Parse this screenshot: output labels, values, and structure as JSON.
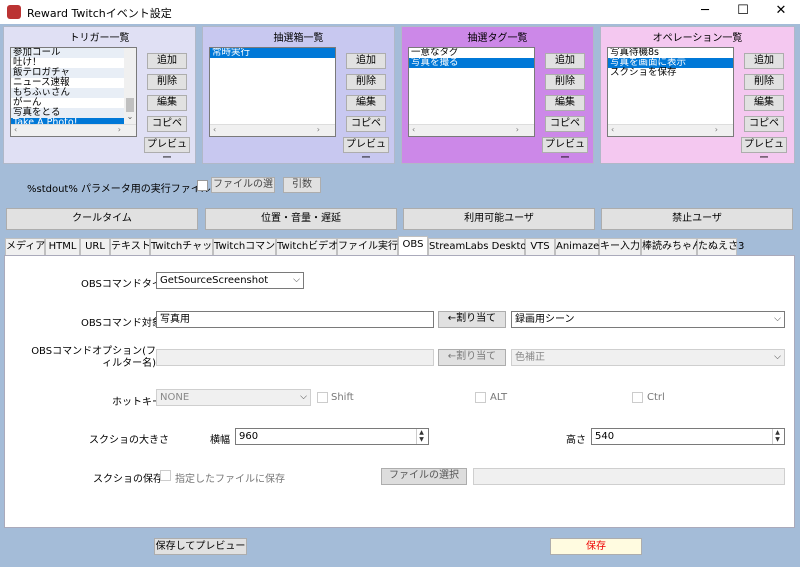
{
  "window": {
    "title": "Reward Twitchイベント設定",
    "minimize": "─",
    "maximize": "☐",
    "close": "✕"
  },
  "panels": [
    {
      "title": "トリガー一覧",
      "items": [
        "参加コール",
        "吐け！",
        "飯テロガチャ",
        "ニュース速報",
        "もちふぃさん",
        "がーん",
        "写真をとる",
        "Take A Photo!"
      ],
      "selected": 7,
      "color": "#e0e0f4"
    },
    {
      "title": "抽選箱一覧",
      "items": [
        "常時実行"
      ],
      "selected": 0,
      "color": "#c8c8f0"
    },
    {
      "title": "抽選タグ一覧",
      "items": [
        "一意なタグ",
        "写真を撮る"
      ],
      "selected": 1,
      "color": "#cc88e8"
    },
    {
      "title": "オペレーション一覧",
      "items": [
        "写真待機8s",
        "写真を画面に表示",
        "スクショを保存"
      ],
      "selected": 1,
      "color": "#f4c8f0"
    }
  ],
  "panel_buttons": [
    "追加",
    "削除",
    "編集",
    "コピペ",
    "プレビュー"
  ],
  "stdout": {
    "label": "%stdout% パラメータ用の実行ファイルを使う",
    "file_button": "ファイルの選",
    "args_button": "引数"
  },
  "big_buttons": [
    "クールタイム",
    "位置・音量・遅延",
    "利用可能ユーザ",
    "禁止ユーザ"
  ],
  "tabs": [
    "メディア",
    "HTML",
    "URL",
    "テキスト",
    "Twitchチャット",
    "Twitchコマンド",
    "Twitchビデオ",
    "ファイル実行",
    "OBS",
    "StreamLabs Desktop",
    "VTS",
    "Animaze",
    "キー入力",
    "棒読みちゃん",
    "たぬえさ3"
  ],
  "active_tab": 8,
  "obs": {
    "command_type_label": "OBSコマンドタイプ",
    "command_type_value": "GetSourceScreenshot",
    "target_label": "OBSコマンド対象",
    "target_value": "写真用",
    "assign_button": "←割り当て",
    "scene_value": "録画用シーン",
    "option_label": "OBSコマンドオプション(フィルター名)",
    "option_value": "",
    "assign_button2": "←割り当て",
    "filter_value": "色補正",
    "hotkey_label": "ホットキー",
    "hotkey_value": "NONE",
    "shift_label": "Shift",
    "alt_label": "ALT",
    "ctrl_label": "Ctrl",
    "size_label": "スクショの大きさ",
    "width_label": "横幅",
    "width_value": "960",
    "height_label": "高さ",
    "height_value": "540",
    "save_label": "スクショの保存",
    "save_check_label": "指定したファイルに保存",
    "file_select_button": "ファイルの選択",
    "file_path": ""
  },
  "footer": {
    "save_preview": "保存してプレビュー",
    "save": "保存"
  }
}
